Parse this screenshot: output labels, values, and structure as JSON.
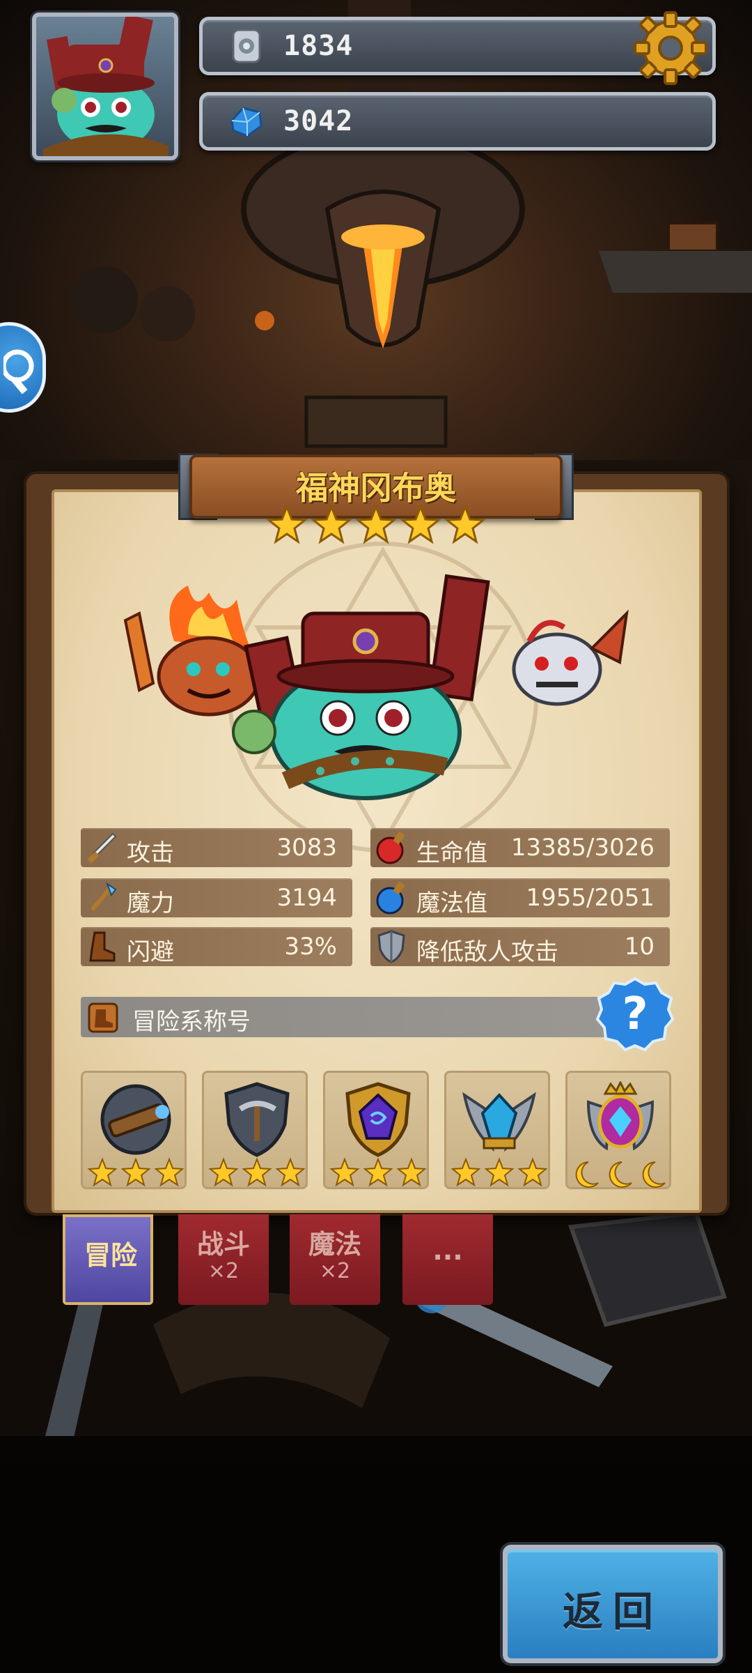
{
  "hud": {
    "currency_silver": "1834",
    "currency_gems": "3042"
  },
  "hero": {
    "name": "福神冈布奥",
    "stars": 5
  },
  "stats": {
    "attack": {
      "label": "攻击",
      "value": "3083"
    },
    "magic_power": {
      "label": "魔力",
      "value": "3194"
    },
    "dodge": {
      "label": "闪避",
      "value": "33%"
    },
    "hp": {
      "label": "生命值",
      "value": "13385/3026"
    },
    "mp": {
      "label": "魔法值",
      "value": "1955/2051"
    },
    "reduce_attack": {
      "label": "降低敌人攻击",
      "value": "10"
    }
  },
  "title_section": {
    "label": "冒险系称号",
    "help": "?"
  },
  "medals": [
    {
      "name": "telescope",
      "stars": 3
    },
    {
      "name": "pickaxe-shield",
      "stars": 3
    },
    {
      "name": "purple-crystal-shield",
      "stars": 3
    },
    {
      "name": "winged-crystal",
      "stars": 3
    },
    {
      "name": "crowned-crest",
      "stars": 3
    }
  ],
  "tabs": [
    {
      "label": "冒险",
      "sub": ""
    },
    {
      "label": "战斗",
      "sub": "×2"
    },
    {
      "label": "魔法",
      "sub": "×2"
    },
    {
      "label": "...",
      "sub": ""
    }
  ],
  "back_button": "返回",
  "colors": {
    "star": "#ffc928",
    "panel": "#efdfbf",
    "back_button": "#3a9ad6",
    "title_text": "#ffd75a"
  }
}
